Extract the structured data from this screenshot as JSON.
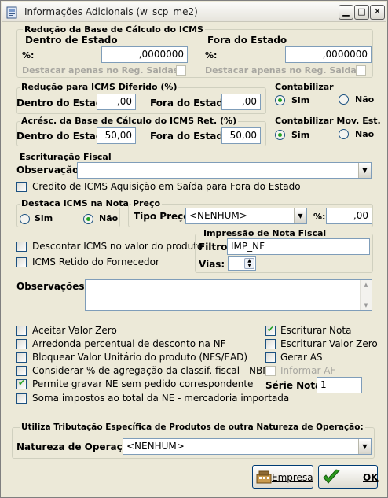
{
  "window": {
    "title": "Informações Adicionais (w_scp_me2)"
  },
  "reducao_base": {
    "group_label": "Redução da Base de Cálculo do ICMS",
    "dentro_label": "Dentro de Estado",
    "fora_label": "Fora do Estado",
    "pct_label": "%:",
    "dentro_value": ",0000000",
    "fora_value": ",0000000",
    "destacar_label": "Destacar apenas no Reg. Saidas"
  },
  "diferido": {
    "group_label": "Redução para ICMS Diferido (%)",
    "dentro_label": "Dentro do Estado:",
    "dentro_value": ",00",
    "fora_label": "Fora do Estado:",
    "fora_value": ",00"
  },
  "contabilizar": {
    "group_label": "Contabilizar",
    "sim": "Sim",
    "nao": "Não",
    "selected": "Sim"
  },
  "acrescimo": {
    "group_label": "Acrésc. da Base de Cálculo do ICMS Ret. (%)",
    "dentro_label": "Dentro do Estado:",
    "dentro_value": "50,00",
    "fora_label": "Fora do Estado:",
    "fora_value": "50,00"
  },
  "contabilizar_mov": {
    "group_label": "Contabilizar Mov. Est.",
    "sim": "Sim",
    "nao": "Não",
    "selected": "Sim"
  },
  "escrituracao": {
    "group_label": "Escrituração Fiscal",
    "obs_label": "Observação :",
    "obs_value": "",
    "credito_label": "Credito de ICMS Aquisição em Saída para Fora do Estado"
  },
  "destaca": {
    "group_label": "Destaca ICMS na Nota",
    "sim": "Sim",
    "nao": "Não",
    "selected": "Não"
  },
  "preco": {
    "group_label": "Preço",
    "tipo_label": "Tipo Preço:",
    "tipo_value": "<NENHUM>",
    "pct_label": "%:",
    "pct_value": ",00"
  },
  "impressao": {
    "group_label": "Impressão de Nota Fiscal",
    "filtro_label": "Filtro:",
    "filtro_value": "IMP_NF",
    "vias_label": "Vias:"
  },
  "desc_icms": "Descontar ICMS no valor do produto",
  "icms_retido": "ICMS Retido do Fornecedor",
  "observacoes_label": "Observações :",
  "options_left": [
    {
      "label": "Aceitar Valor Zero",
      "checked": false
    },
    {
      "label": "Arredonda percentual de desconto na NF",
      "checked": false
    },
    {
      "label": "Bloquear Valor Unitário do produto (NFS/EAD)",
      "checked": false
    },
    {
      "label": "Considerar % de agregação da classif. fiscal - NBM",
      "checked": false
    },
    {
      "label": "Permite gravar NE sem pedido correspondente",
      "checked": true
    },
    {
      "label": "Soma impostos ao total da NE - mercadoria importada",
      "checked": false
    }
  ],
  "options_right": [
    {
      "label": "Escriturar Nota",
      "checked": true
    },
    {
      "label": "Escriturar Valor Zero",
      "checked": false
    },
    {
      "label": "Gerar AS",
      "checked": false
    },
    {
      "label": "Informar AF",
      "checked": false,
      "disabled": true
    }
  ],
  "serie": {
    "label": "Série Nota:",
    "value": "1"
  },
  "tributacao": {
    "group_label": "Utiliza Tributação Específica de Produtos de outra Natureza de Operação:",
    "natureza_label": "Natureza de Operação :",
    "natureza_value": "<NENHUM>"
  },
  "buttons": {
    "empresa": "Empresa",
    "ok": "OK"
  }
}
